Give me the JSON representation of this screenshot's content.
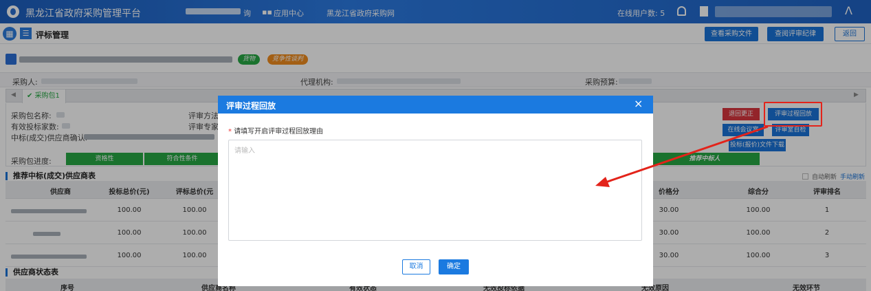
{
  "header": {
    "app_title": "黑龙江省政府采购管理平台",
    "nav_partial": "询",
    "app_center": "应用中心",
    "procurement_net": "黑龙江省政府采购网",
    "online_users_label": "在线用户数:",
    "online_users_count": "5"
  },
  "subbar": {
    "title": "评标管理",
    "btn_view_files": "查看采购文件",
    "btn_view_records": "查阅评审纪律",
    "btn_back": "返回"
  },
  "project": {
    "badge_goods": "货物",
    "badge_method": "竞争性谈判"
  },
  "info": {
    "purchaser_label": "采购人:",
    "agency_label": "代理机构:",
    "budget_label": "采购预算:"
  },
  "package_tab": "采购包1",
  "details": {
    "pkg_name_label": "采购包名称:",
    "valid_bidders_label": "有效投标家数:",
    "winner_confirm_label": "中标(成交)供应商确认:",
    "eval_method_label": "评审方法",
    "eval_expert_label": "评审专家"
  },
  "actions": {
    "return_correct": "退回更正",
    "eval_playback": "评审过程回放",
    "in_meeting_room": "在线会议室",
    "eval_room_check": "评审室自检",
    "bid_file_download": "投标(报价)文件下载"
  },
  "progress": {
    "label": "采购包进度:",
    "steps": [
      "资格性",
      "符合性条件",
      "推荐中标人"
    ]
  },
  "recommend_table": {
    "section_title": "推荐中标(成交)供应商表",
    "auto_refresh": "自动刷新",
    "manual_refresh": "手动刷新",
    "headers": [
      "供应商",
      "投标总价(元)",
      "评标总价(元",
      "价格分",
      "综合分",
      "评审排名"
    ],
    "rows": [
      {
        "bid_total": "100.00",
        "eval_total": "100.00",
        "price_score": "30.00",
        "total_score": "100.00",
        "rank": "1"
      },
      {
        "bid_total": "100.00",
        "eval_total": "100.00",
        "price_score": "30.00",
        "total_score": "100.00",
        "rank": "2"
      },
      {
        "bid_total": "100.00",
        "eval_total": "100.00",
        "price_score": "30.00",
        "total_score": "100.00",
        "rank": "3"
      }
    ]
  },
  "status_table": {
    "section_title": "供应商状态表",
    "headers": [
      "序号",
      "供应商名称",
      "有效状态",
      "无效投标依据",
      "无效原因",
      "无效环节"
    ]
  },
  "modal": {
    "title": "评审过程回放",
    "close": "×",
    "required_mark": "*",
    "prompt": "请填写开启评审过程回放理由",
    "placeholder": "请输入",
    "cancel": "取消",
    "confirm": "确定"
  },
  "colors": {
    "primary": "#1b7ae0",
    "header_bg": "#2c7be3",
    "success": "#27a845",
    "danger": "#d9363e",
    "annotation": "#e3231a"
  }
}
